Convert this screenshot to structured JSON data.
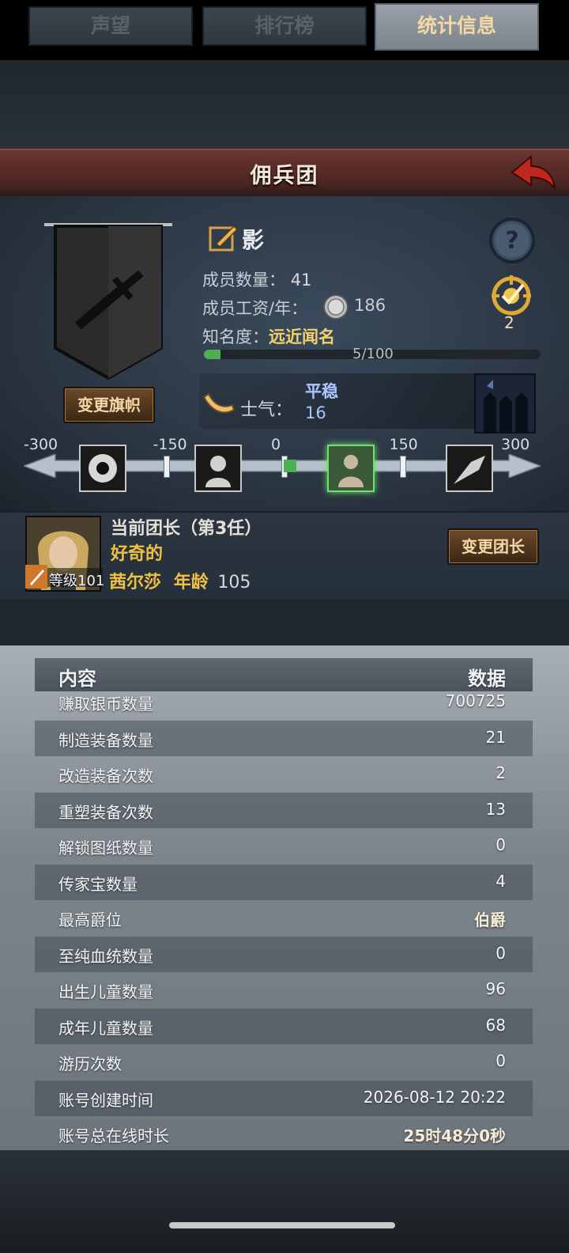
{
  "header": {
    "title": "佣兵团"
  },
  "company": {
    "name": "影",
    "members_label": "成员数量：",
    "members_value": "41",
    "wage_label": "成员工资/年：",
    "wage_value": "186",
    "fame_label": "知名度：",
    "fame_value": "远近闻名",
    "fame_progress_text": "5/100",
    "fame_progress": 0.05,
    "change_banner_label": "变更旗帜",
    "quest_count": "2"
  },
  "morale": {
    "label": "士气：",
    "state": "平稳",
    "value": "16",
    "scale": {
      "min": -300,
      "max": 300,
      "current": 16,
      "ticks": [
        "-300",
        "-150",
        "0",
        "150",
        "300"
      ]
    }
  },
  "leader": {
    "title": "当前团长（第3任）",
    "trait": "好奇的",
    "name": "茜尔莎",
    "age_label": "年龄",
    "age_value": "105",
    "level_label": "等级",
    "level_value": "101",
    "change_leader_label": "变更团长"
  },
  "tabs": [
    {
      "label": "声望",
      "active": false
    },
    {
      "label": "排行榜",
      "active": false
    },
    {
      "label": "统计信息",
      "active": true
    }
  ],
  "stats": {
    "col_content": "内容",
    "col_data": "数据",
    "rows": [
      {
        "k": "赚取银币数量",
        "v": "700725"
      },
      {
        "k": "制造装备数量",
        "v": "21"
      },
      {
        "k": "改造装备次数",
        "v": "2"
      },
      {
        "k": "重塑装备次数",
        "v": "13"
      },
      {
        "k": "解锁图纸数量",
        "v": "0"
      },
      {
        "k": "传家宝数量",
        "v": "4"
      },
      {
        "k": "最高爵位",
        "v": "伯爵"
      },
      {
        "k": "至纯血统数量",
        "v": "0"
      },
      {
        "k": "出生儿童数量",
        "v": "96"
      },
      {
        "k": "成年儿童数量",
        "v": "68"
      },
      {
        "k": "游历次数",
        "v": "0"
      },
      {
        "k": "账号创建时间",
        "v": "2026-08-12 20:22"
      },
      {
        "k": "账号总在线时长",
        "v": "25时48分0秒"
      }
    ]
  }
}
